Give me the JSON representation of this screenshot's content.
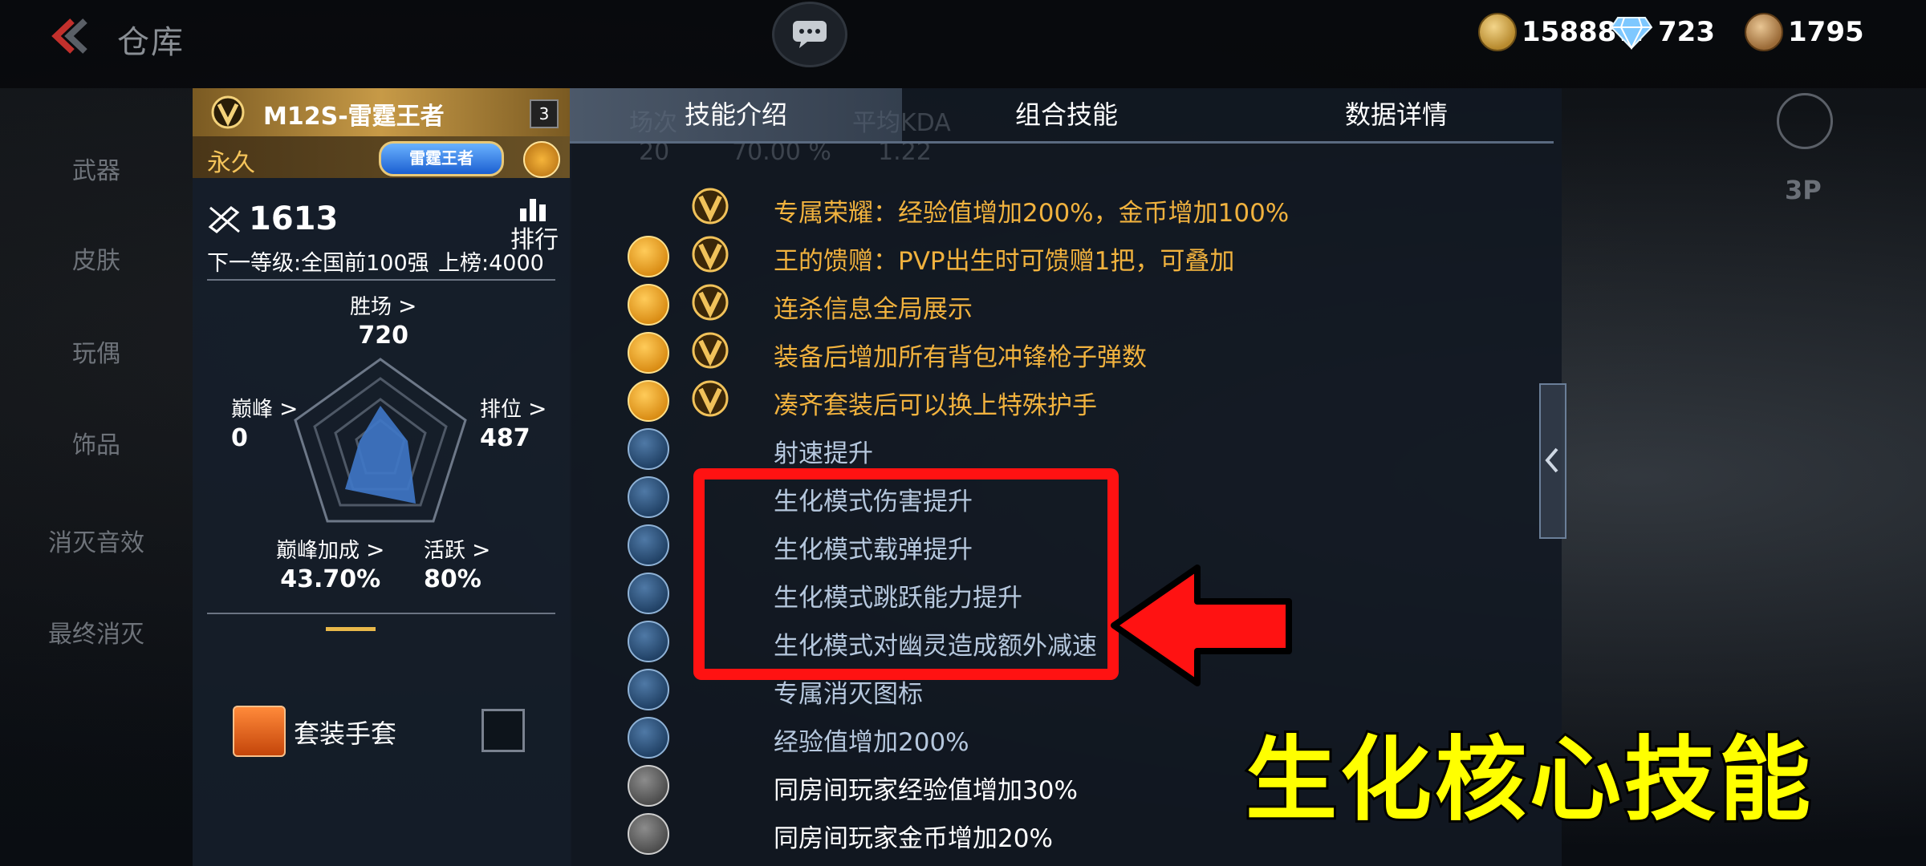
{
  "topbar": {
    "back_title": "仓库",
    "currencies": [
      {
        "name": "gold-coin",
        "value": "15888W"
      },
      {
        "name": "diamond",
        "value": "723"
      },
      {
        "name": "medal",
        "value": "1795"
      }
    ]
  },
  "left_nav": [
    "武器",
    "皮肤",
    "玩偶",
    "饰品",
    "消灭音效",
    "最终消灭"
  ],
  "card": {
    "weapon_name": "M12S-雷霆王者",
    "level": "3",
    "permanence": "永久",
    "title_plate": "雷霆王者",
    "rank_value": "1613",
    "rank_button": "排行",
    "next_level": "下一等级:全国前100强",
    "leaderboard": "上榜:4000",
    "stats": {
      "wins_label": "胜场",
      "wins_value": "720",
      "peak_label": "巅峰",
      "peak_value": "0",
      "ranked_label": "排位",
      "ranked_value": "487",
      "peak_bonus_label": "巅峰加成",
      "peak_bonus_value": "43.70%",
      "active_label": "活跃",
      "active_value": "80%"
    },
    "glove_label": "套装手套"
  },
  "panel": {
    "tabs": [
      "技能介绍",
      "组合技能",
      "数据详情"
    ],
    "active_tab": 0,
    "ghost_headers": [
      "场次",
      "平均KDA"
    ],
    "ghost_values": [
      "20",
      "70.00 %",
      "1.22"
    ],
    "skills": [
      {
        "icon": "v-emblem",
        "style": "gold",
        "v": true,
        "text": "专属荣耀：经验值增加200%，金币增加100%"
      },
      {
        "icon": "gift-icon",
        "style": "gold",
        "v": true,
        "text": "王的馈赠：PVP出生时可馈赠1把，可叠加"
      },
      {
        "icon": "ammo-belt-icon",
        "style": "gold",
        "v": true,
        "text": "连杀信息全局展示"
      },
      {
        "icon": "smg-icon",
        "style": "gold",
        "v": true,
        "text": "装备后增加所有背包冲锋枪子弹数"
      },
      {
        "icon": "star-icon",
        "style": "gold",
        "v": true,
        "text": "凑齐套装后可以换上特殊护手"
      },
      {
        "icon": "bullet-speed-icon",
        "style": "blue",
        "v": false,
        "text": "射速提升"
      },
      {
        "icon": "bio-damage-icon",
        "style": "blue",
        "v": false,
        "text": "生化模式伤害提升"
      },
      {
        "icon": "bio-ammo-icon",
        "style": "blue",
        "v": false,
        "text": "生化模式载弹提升"
      },
      {
        "icon": "bio-jump-icon",
        "style": "blue",
        "v": false,
        "text": "生化模式跳跃能力提升"
      },
      {
        "icon": "bio-slow-icon",
        "style": "blue",
        "v": false,
        "text": "生化模式对幽灵造成额外减速"
      },
      {
        "icon": "kill-icon",
        "style": "blue",
        "v": false,
        "text": "专属消灭图标"
      },
      {
        "icon": "exp-icon",
        "style": "blue",
        "v": false,
        "text": "经验值增加200%"
      },
      {
        "icon": "room-exp-icon",
        "style": "gray",
        "v": false,
        "text": "同房间玩家经验值增加30%"
      },
      {
        "icon": "room-gold-icon",
        "style": "gray",
        "v": false,
        "text": "同房间玩家金币增加20%"
      }
    ]
  },
  "overlay": {
    "caption": "生化核心技能"
  },
  "hud": {
    "view_mode": "3P"
  },
  "colors": {
    "gold_text": "#f1b23e",
    "blue_text": "#b6c8de",
    "highlight_red": "#ff1212",
    "caption_yellow": "#ffff00"
  }
}
